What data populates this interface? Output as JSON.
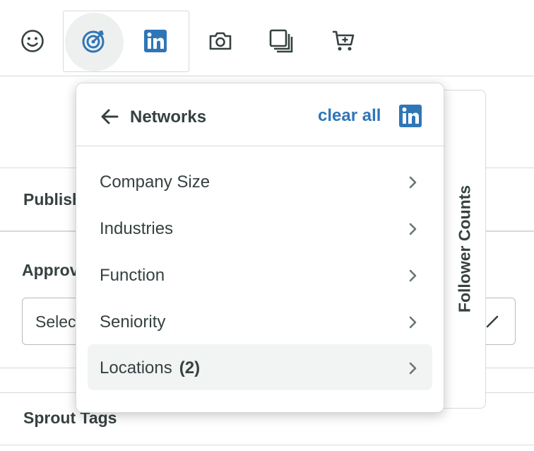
{
  "toolbar": {
    "icons": [
      {
        "name": "smiley-icon"
      },
      {
        "name": "targeting-icon",
        "color": "#2f76b7"
      },
      {
        "name": "linkedin-icon",
        "color": "#2f76b7"
      },
      {
        "name": "camera-icon"
      },
      {
        "name": "gallery-icon"
      },
      {
        "name": "shopping-cart-icon"
      }
    ]
  },
  "form": {
    "publish_label": "Publish",
    "approval_label": "Approval",
    "select_placeholder": "Select",
    "sprout_tags_label": "Sprout Tags"
  },
  "side_panel": {
    "label": "Follower Counts"
  },
  "popover": {
    "title": "Networks",
    "clear_all": "clear all",
    "items": [
      {
        "label": "Company Size",
        "count": ""
      },
      {
        "label": "Industries",
        "count": ""
      },
      {
        "label": "Function",
        "count": ""
      },
      {
        "label": "Seniority",
        "count": ""
      },
      {
        "label": "Locations",
        "count": "(2)"
      }
    ]
  },
  "colors": {
    "accent": "#2f76b7",
    "text": "#364141",
    "border": "#d7dada",
    "selected_row": "#f2f3f3"
  }
}
